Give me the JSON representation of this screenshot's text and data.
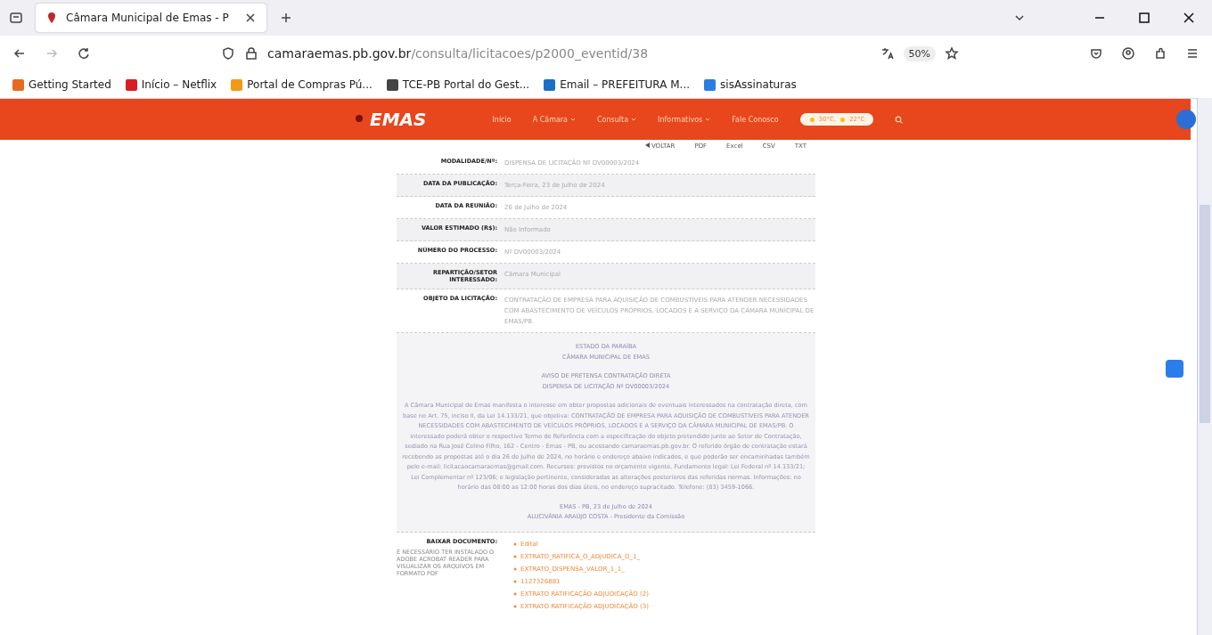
{
  "browser": {
    "tab_title": "Câmara Municipal de Emas - P",
    "url_host": "camaraemas.pb.gov.br",
    "url_path": "/consulta/licitacoes/p2000_eventid/38",
    "zoom": "50%",
    "bookmarks": [
      {
        "label": "Getting Started",
        "color": "#e66a1f"
      },
      {
        "label": "Início – Netflix",
        "color": "#d81f26"
      },
      {
        "label": "Portal de Compras Pú...",
        "color": "#f29a16"
      },
      {
        "label": "TCE-PB Portal do Gest...",
        "color": "#444444"
      },
      {
        "label": "Email – PREFEITURA M...",
        "color": "#1a6fc9"
      },
      {
        "label": "sisAssinaturas",
        "color": "#2a7de1"
      }
    ]
  },
  "site": {
    "logo": "EMAS",
    "menu": [
      {
        "label": "Início",
        "dropdown": false
      },
      {
        "label": "A Câmara",
        "dropdown": true
      },
      {
        "label": "Consulta",
        "dropdown": true
      },
      {
        "label": "Informativos",
        "dropdown": true
      },
      {
        "label": "Fale Conosco",
        "dropdown": false
      }
    ],
    "weather": [
      "30°C,",
      "22°C"
    ]
  },
  "actions": [
    {
      "label": "VOLTAR",
      "kind": "back"
    },
    {
      "label": "PDF",
      "kind": "export"
    },
    {
      "label": "Excel",
      "kind": "export"
    },
    {
      "label": "CSV",
      "kind": "export"
    },
    {
      "label": "TXT",
      "kind": "export"
    }
  ],
  "details": [
    {
      "label": "MODALIDADE/Nº:",
      "value": "DISPENSA DE LICITAÇÃO Nº DV00003/2024"
    },
    {
      "label": "DATA DA PUBLICAÇÃO:",
      "value": "Terça-Feira, 23 de Julho de 2024"
    },
    {
      "label": "DATA DA REUNIÃO:",
      "value": "26 de Julho de 2024"
    },
    {
      "label": "VALOR ESTIMADO (R$):",
      "value": "Não Informado"
    },
    {
      "label": "NÚMERO DO PROCESSO:",
      "value": "Nº DV00003/2024"
    },
    {
      "label": "REPARTIÇÃO/SETOR INTERESSADO:",
      "value": "Câmara Municipal"
    },
    {
      "label": "OBJETO DA LICITAÇÃO:",
      "value": "CONTRATAÇÃO DE EMPRESA PARA AQUISIÇÃO DE COMBUSTIVEIS PARA ATENDER NECESSIDADES COM ABASTECIMENTO DE VEÍCULOS PRÓPRIOS, LOCADOS E A SERVIÇO DA CÂMARA MUNICIPAL DE EMAS/PB."
    }
  ],
  "notice": {
    "header": [
      "ESTADO DA PARAÍBA",
      "CÂMARA MUNICIPAL DE EMAS"
    ],
    "title": [
      "AVISO DE PRETENSA CONTRATAÇÃO DIRETA",
      "DISPENSA DE LICITAÇÃO Nº DV00003/2024"
    ],
    "body": "A Câmara Municipal de Emas manifesta o interesse em obter propostas adicionais de eventuais interessados na contratação direta, com base no Art. 75, inciso II, da Lei 14.133/21, que objetiva: CONTRATAÇÃO DE EMPRESA PARA AQUISIÇÃO DE COMBUSTIVEIS PARA ATENDER NECESSIDADES COM ABASTECIMENTO DE VEÍCULOS PRÓPRIOS, LOCADOS E A SERVIÇO DA CÂMARA MUNICIPAL DE EMAS/PB. O interessado poderá obter o respectivo Termo de Referência com a especificação do objeto pretendido junto ao Setor de Contratação, sediado na Rua José Celino Filho, 162 - Centro - Emas - PB, ou acessando camaraemas.pb.gov.br. O referido órgão de contratação estará recebendo as propostas até o dia 26 de Julho de 2024, no horário e endereço abaixo indicados, e que poderão ser encaminhadas também pelo e-mail: licitacaocamaraemas@gmail.com. Recursos: previstos no orçamento vigente. Fundamento legal: Lei Federal nº 14.133/21; Lei Complementar nº 123/06; e legislação pertinente, consideradas as alterações posteriores das referidas normas. Informações: no horário das 08:00 as 12:00 horas dos dias úteis, no endereço supracitado. Telefone: (83) 3459-1066.",
    "signature": [
      "EMAS - PB, 23 de Julho de 2024",
      "ALUCIVÂNIA ARAÚJO COSTA - Presidente da Comissão"
    ]
  },
  "downloads": {
    "label": "BAIXAR DOCUMENTO:",
    "note": "É NECESSÁRIO TER INSTALADO O ADOBE ACROBAT READER PARA VISUALIZAR OS ARQUIVOS EM FORMATO PDF",
    "files": [
      "Edital",
      "EXTRATO_RATIFICA_O_ADJUDICA_O_1_",
      "EXTRATO_DISPENSA_VALOR_1_1_",
      "1127326881",
      "EXTRATO RATIFICAÇÃO ADJUDICAÇÃO (2)",
      "EXTRATO RATIFICAÇÃO ADJUDICAÇÃO (3)"
    ]
  }
}
